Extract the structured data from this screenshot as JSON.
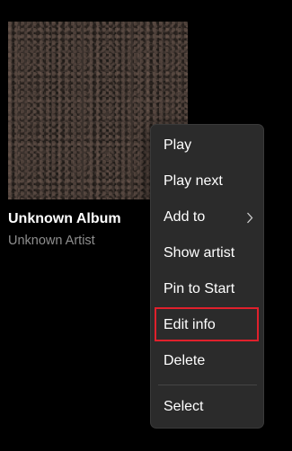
{
  "album": {
    "title": "Unknown Album",
    "artist": "Unknown Artist"
  },
  "context_menu": {
    "items": [
      {
        "label": "Play"
      },
      {
        "label": "Play next"
      },
      {
        "label": "Add to",
        "submenu_icon": "chevron-right-icon"
      },
      {
        "label": "Show artist"
      },
      {
        "label": "Pin to Start"
      },
      {
        "label": "Edit info",
        "highlighted": true
      },
      {
        "label": "Delete"
      },
      {
        "label": "Select"
      }
    ]
  },
  "colors": {
    "background": "#000000",
    "menu_background": "#2b2b2b",
    "highlight_border": "#e0202c",
    "secondary_text": "#8e8e8e"
  }
}
